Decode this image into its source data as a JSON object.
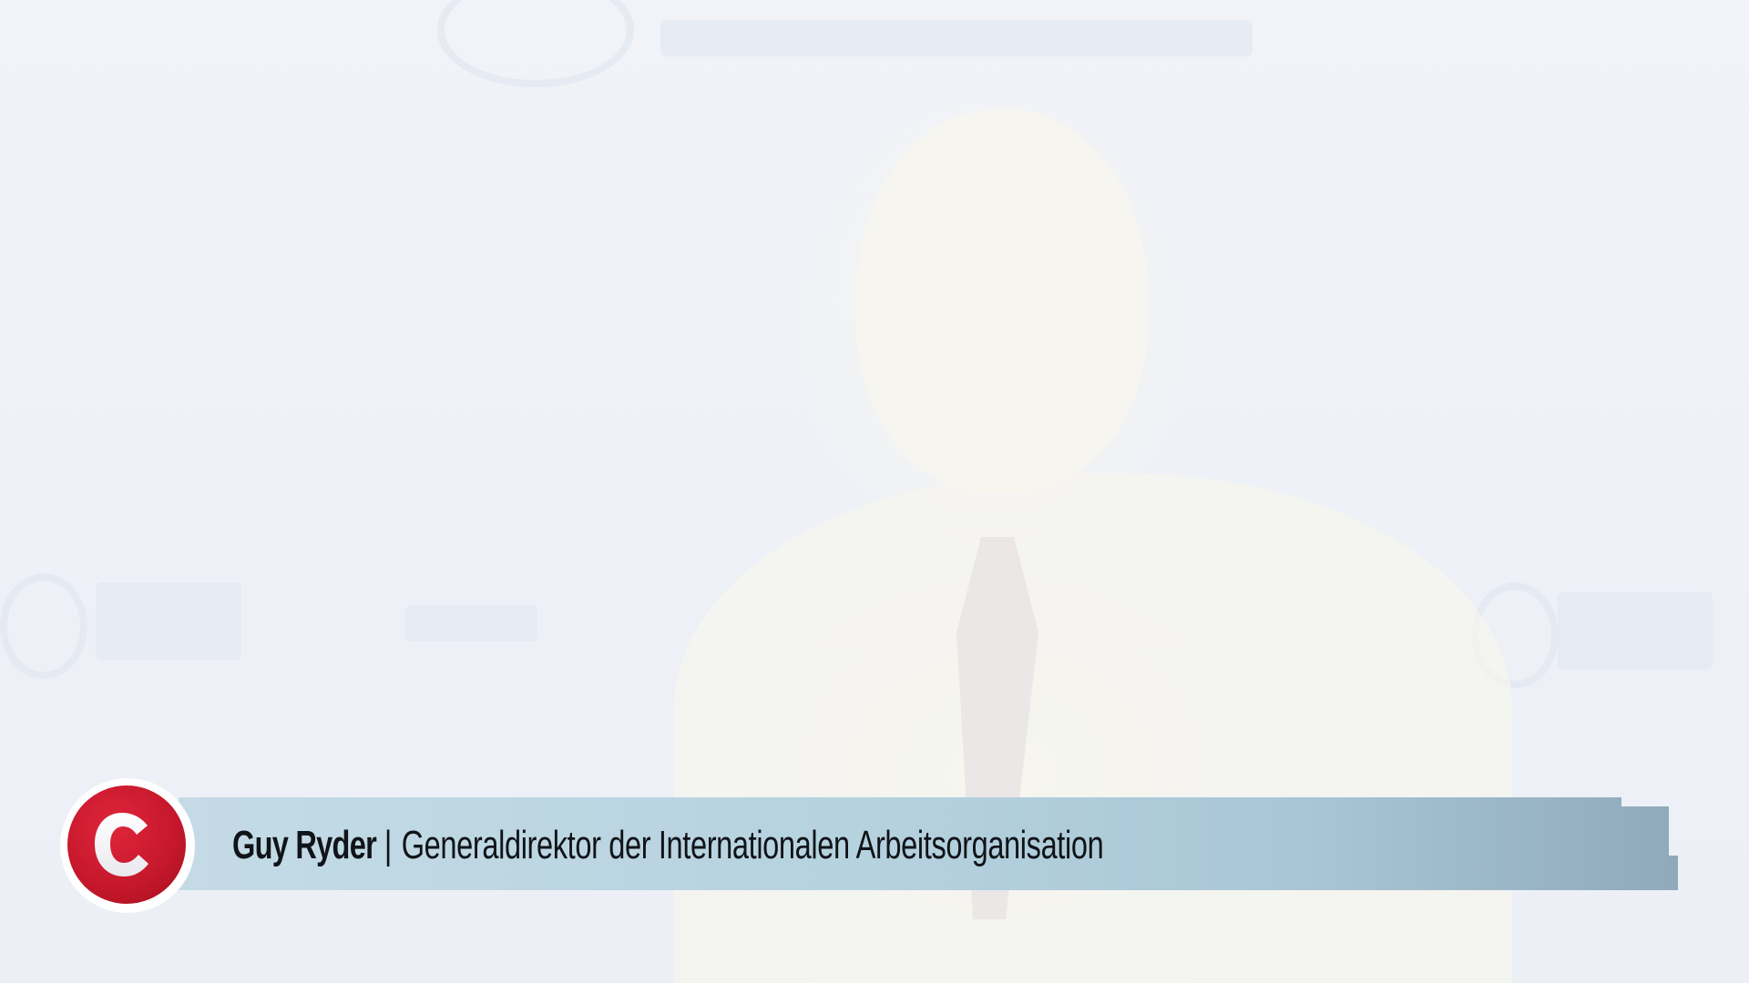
{
  "lower_third": {
    "name": "Guy Ryder",
    "separator": "|",
    "title": "Generaldirektor der Internationalen Arbeitsorganisation"
  },
  "channel_logo": {
    "letter": "C",
    "colors": {
      "disc": "#c4172b",
      "letter": "#ffffff",
      "ring": "#ffffff"
    }
  },
  "colors": {
    "banner_start": "#c4dbe6",
    "banner_end": "#8eaabb",
    "text": "#101418",
    "background": "#eef1f7"
  }
}
